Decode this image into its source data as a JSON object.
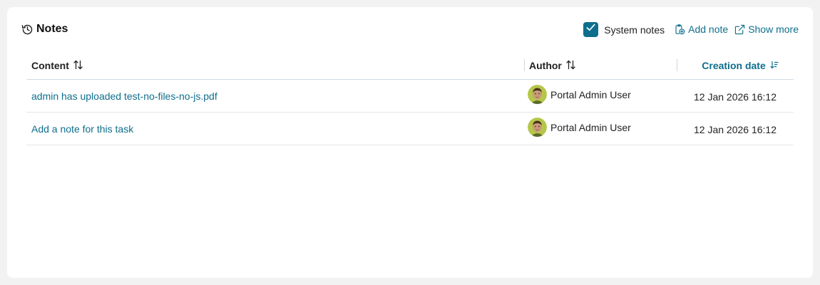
{
  "header": {
    "title": "Notes",
    "title_icon": "history-icon",
    "system_notes_label": "System notes",
    "system_notes_checked": true,
    "add_note_label": "Add note",
    "add_note_icon": "add-note-icon",
    "show_more_label": "Show more",
    "show_more_icon": "external-link-icon"
  },
  "table": {
    "columns": [
      {
        "label": "Content",
        "sort_icon": "sort-icon"
      },
      {
        "label": "Author",
        "sort_icon": "sort-icon"
      },
      {
        "label": "Creation date",
        "sort_icon": "sort-descending-icon"
      }
    ],
    "rows": [
      {
        "content": "admin has uploaded test-no-files-no-js.pdf",
        "author": "Portal Admin User",
        "date": "12 Jan 2026 16:12"
      },
      {
        "content": "Add a note for this task",
        "author": "Portal Admin User",
        "date": "12 Jan 2026 16:12"
      }
    ]
  },
  "colors": {
    "accent": "#0e6e8c",
    "text": "#222222",
    "background": "#f2f2f2",
    "card": "#ffffff"
  }
}
